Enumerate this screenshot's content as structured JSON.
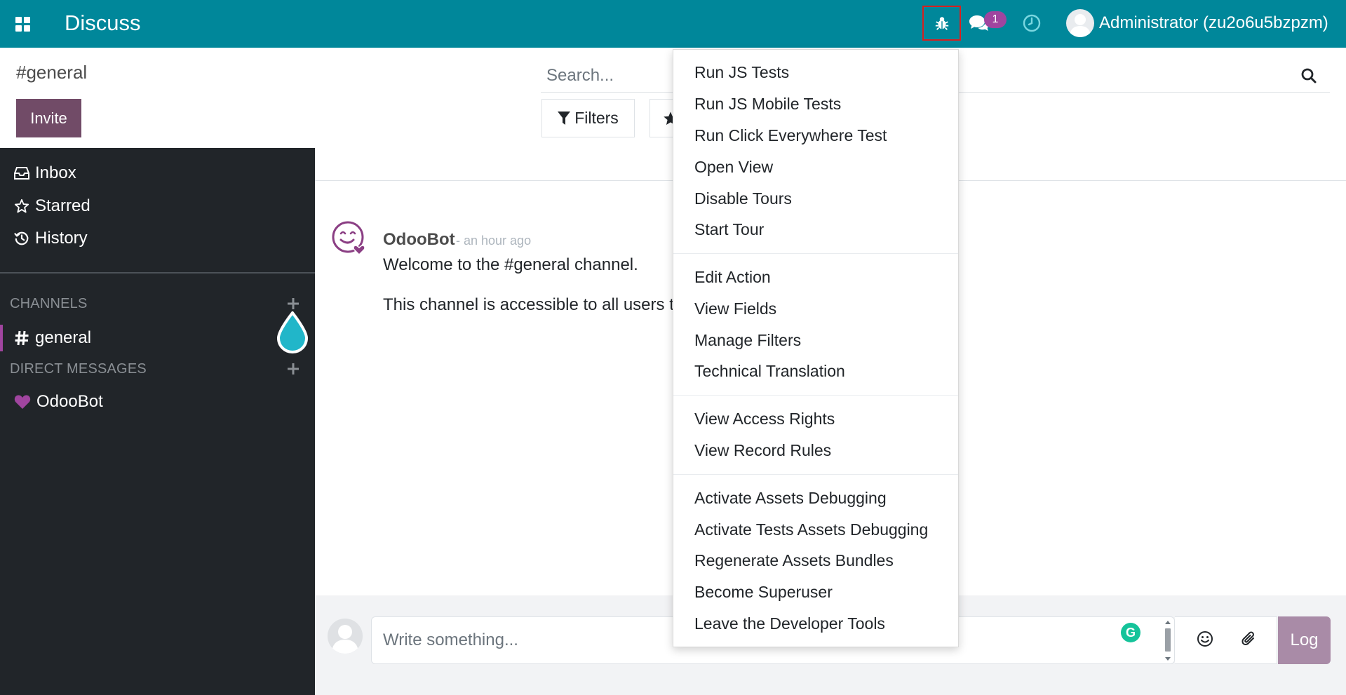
{
  "navbar": {
    "app_title": "Discuss",
    "chat_count": "1",
    "user_name": "Administrator (zu2o6u5bzpzm)",
    "brand_color": "#00879a"
  },
  "control_panel": {
    "breadcrumb": "#general",
    "invite_label": "Invite",
    "search_placeholder": "Search...",
    "filters_label": "Filters"
  },
  "sidebar": {
    "mailboxes": [
      {
        "label": "Inbox",
        "icon": "inbox-icon"
      },
      {
        "label": "Starred",
        "icon": "star-icon"
      },
      {
        "label": "History",
        "icon": "history-icon"
      }
    ],
    "channels_header": "CHANNELS",
    "channels": [
      {
        "label": "general",
        "icon": "hash-icon"
      }
    ],
    "dm_header": "DIRECT MESSAGES",
    "direct_messages": [
      {
        "label": "OdooBot",
        "icon": "heart-icon"
      }
    ]
  },
  "thread": {
    "author": "OdooBot",
    "date": "- an hour ago",
    "line1": "Welcome to the #general channel.",
    "line2": "This channel is accessible to all users t"
  },
  "composer": {
    "placeholder": "Write something...",
    "log_label": "Log",
    "grammarly_letter": "G"
  },
  "debug_menu": {
    "groups": [
      [
        "Run JS Tests",
        "Run JS Mobile Tests",
        "Run Click Everywhere Test",
        "Open View",
        "Disable Tours",
        "Start Tour"
      ],
      [
        "Edit Action",
        "View Fields",
        "Manage Filters",
        "Technical Translation"
      ],
      [
        "View Access Rights",
        "View Record Rules"
      ],
      [
        "Activate Assets Debugging",
        "Activate Tests Assets Debugging",
        "Regenerate Assets Bundles",
        "Become Superuser",
        "Leave the Developer Tools"
      ]
    ]
  },
  "colors": {
    "accent_purple": "#714b67",
    "badge_purple": "#a0459f",
    "sidebar_bg": "#212529",
    "debug_highlight": "#d6201f"
  }
}
